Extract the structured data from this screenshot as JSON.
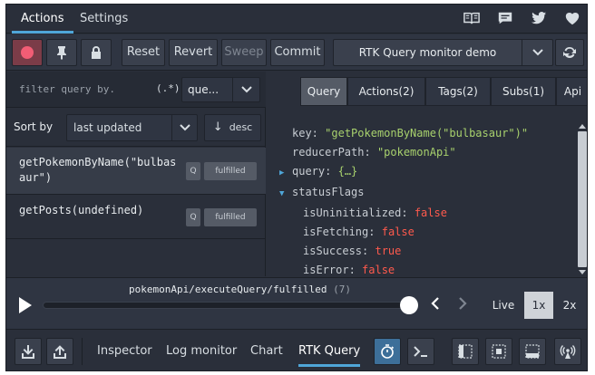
{
  "top_tabs": [
    "Actions",
    "Settings"
  ],
  "top_links": [
    "docs-icon",
    "discussions-icon",
    "twitter-icon",
    "heart-icon"
  ],
  "toolbar": {
    "reset": "Reset",
    "revert": "Revert",
    "sweep": "Sweep",
    "commit": "Commit",
    "instance": "RTK Query monitor demo"
  },
  "filter": {
    "placeholder": "filter query by.",
    "regex": "(.*)",
    "mode": "que..."
  },
  "sort": {
    "label": "Sort by",
    "value": "last updated",
    "order_arrow": "↓",
    "order": "desc"
  },
  "queries": [
    {
      "name": "getPokemonByName(\"bulbasaur\")",
      "type": "Q",
      "status": "fulfilled"
    },
    {
      "name": "getPosts(undefined)",
      "type": "Q",
      "status": "fulfilled"
    }
  ],
  "detail_tabs": [
    "Query",
    "Actions(2)",
    "Tags(2)",
    "Subs(1)",
    "Api"
  ],
  "tree": {
    "key_label": "key:",
    "key_value": "\"getPokemonByName(\"bulbasaur\")\"",
    "path_label": "reducerPath:",
    "path_value": "\"pokemonApi\"",
    "query_label": "query:",
    "query_value": "{…}",
    "flags_label": "statusFlags",
    "flags": [
      {
        "label": "isUninitialized:",
        "value": "false",
        "color": "#ff5a4d"
      },
      {
        "label": "isFetching:",
        "value": "false",
        "color": "#ff5a4d"
      },
      {
        "label": "isSuccess:",
        "value": "true",
        "color": "#ff5a4d"
      },
      {
        "label": "isError:",
        "value": "false",
        "color": "#ff5a4d"
      }
    ]
  },
  "slider": {
    "action": "pokemonApi/executeQuery/fulfilled",
    "count": "(7)",
    "position": 1.0,
    "live": "Live",
    "speeds": [
      "1x",
      "2x"
    ]
  },
  "monitors": [
    "Inspector",
    "Log monitor",
    "Chart",
    "RTK Query"
  ],
  "colors": {
    "accent": "#4fa6d8",
    "record": "#f25d75",
    "string": "#a8d16d",
    "boolean": "#ff5a4d"
  }
}
